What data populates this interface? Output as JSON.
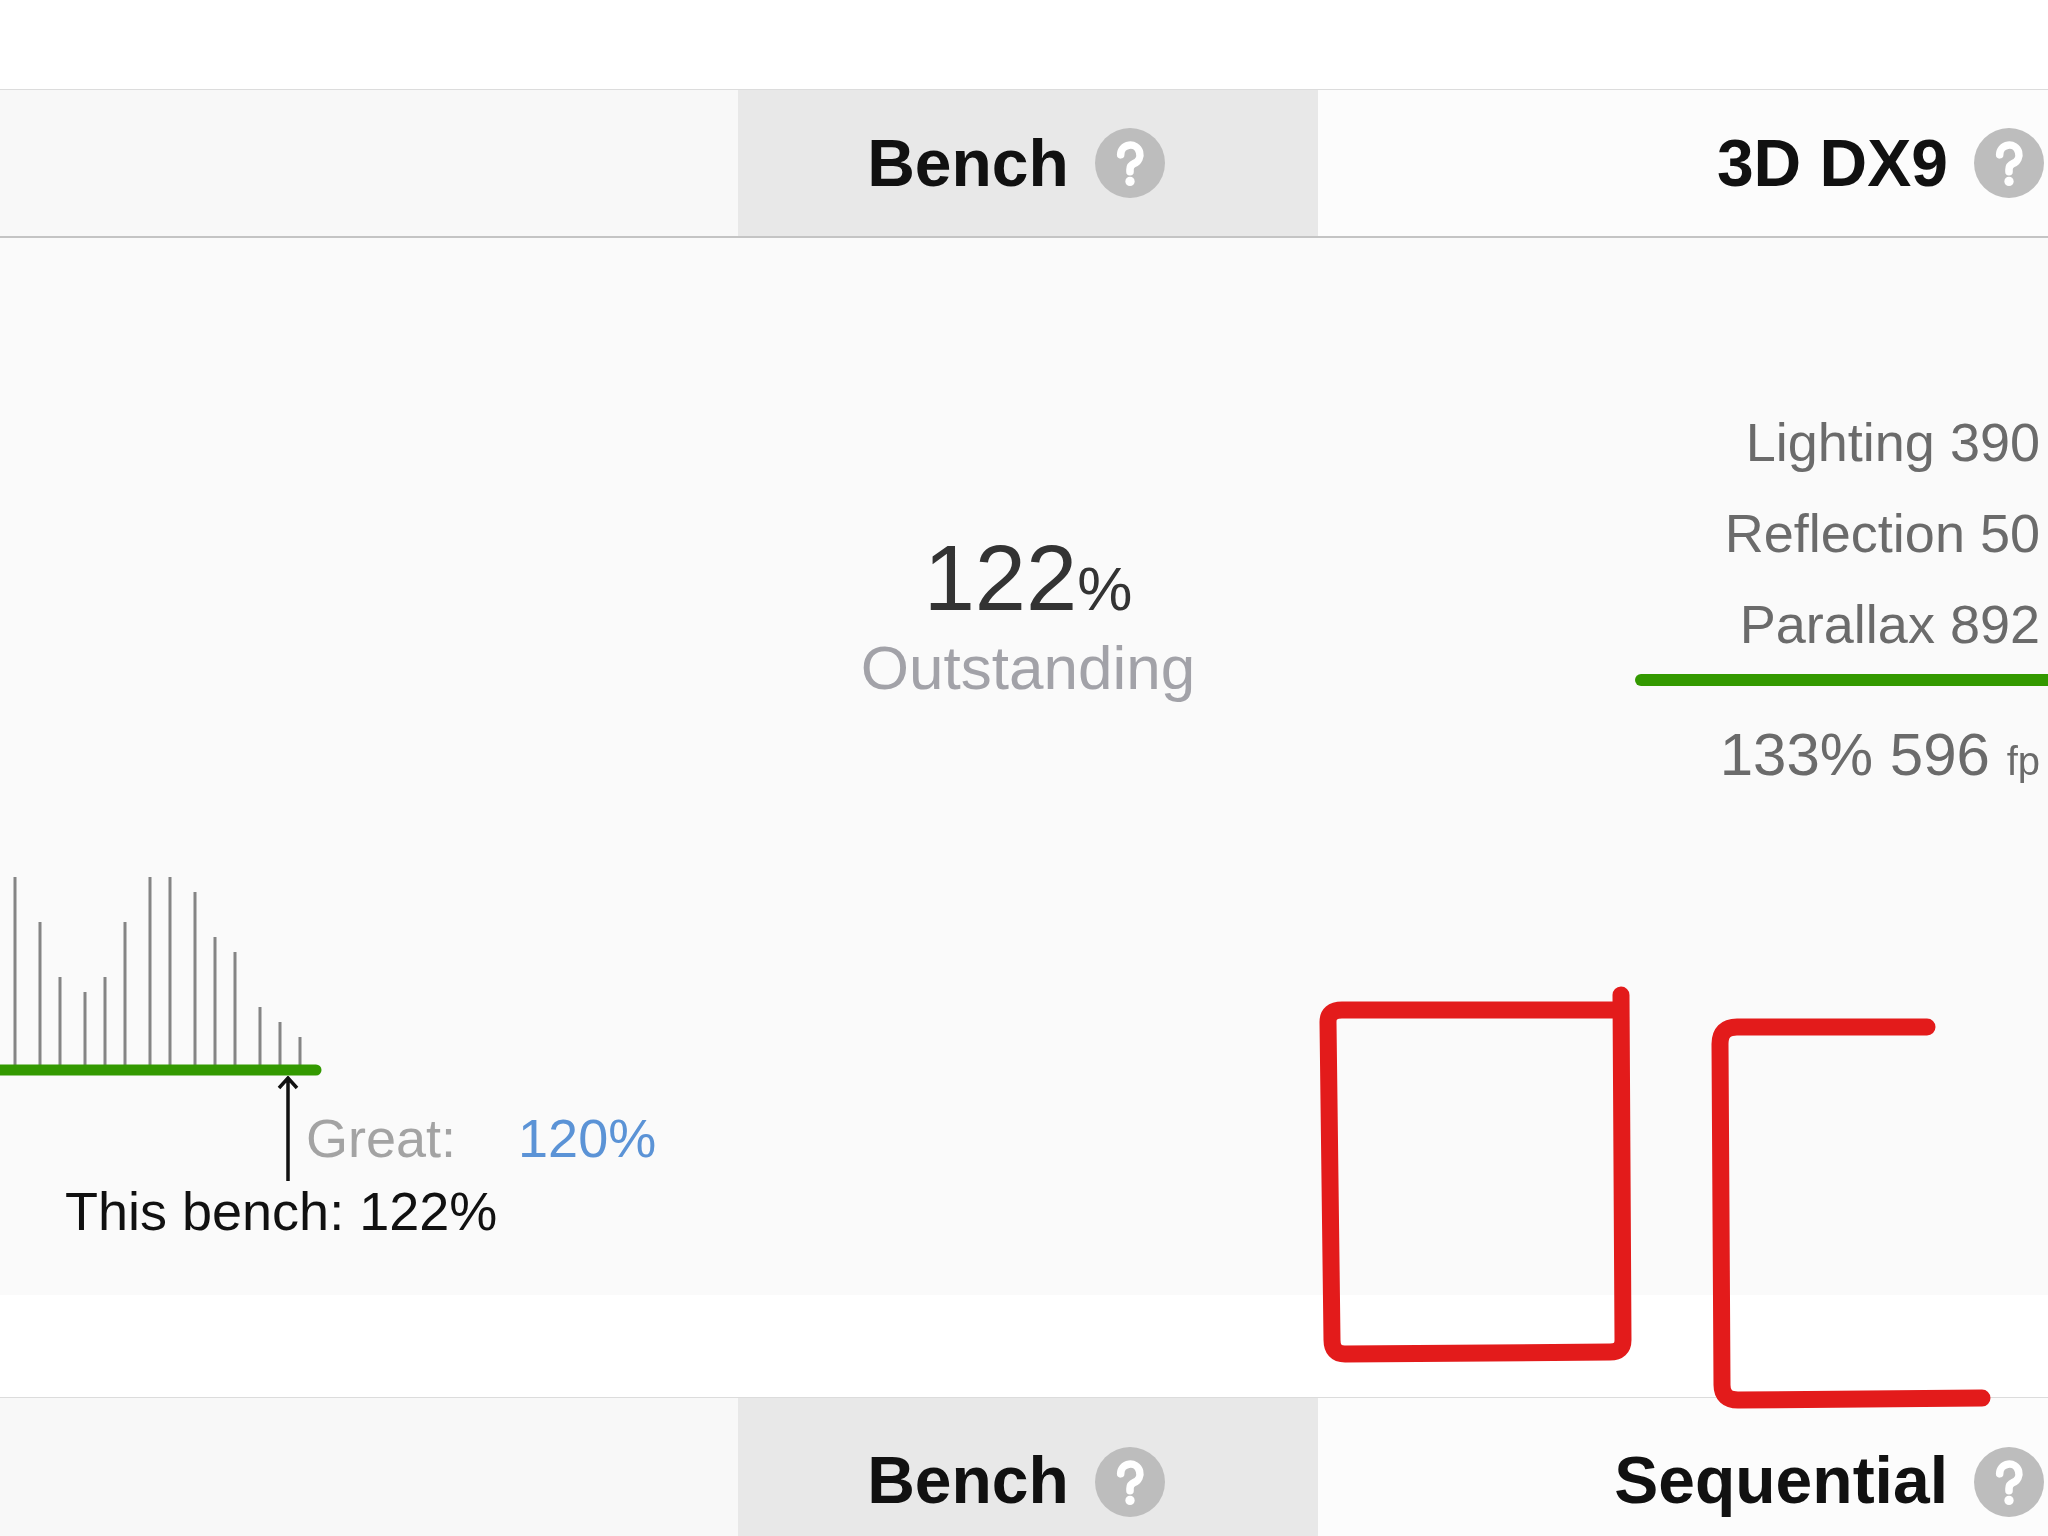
{
  "benchmark_table": {
    "header": [
      {
        "label": "Bench",
        "highlighted": true
      },
      {
        "label": "3D DX9",
        "highlighted": false
      }
    ],
    "row": {
      "distribution": {
        "threshold_label": "Great:",
        "threshold_value": "120%",
        "marker_label": "This bench: 122%"
      },
      "bench": {
        "score": "122",
        "unit": "%",
        "rating": "Outstanding"
      },
      "dx9": {
        "subtests": [
          "Lighting 390",
          "Reflection 50",
          "Parallax 892"
        ],
        "total": "133% 596",
        "unit": "fp"
      }
    },
    "next_header": [
      {
        "label": "Bench",
        "highlighted": true
      },
      {
        "label": "Sequential",
        "highlighted": false
      }
    ]
  }
}
